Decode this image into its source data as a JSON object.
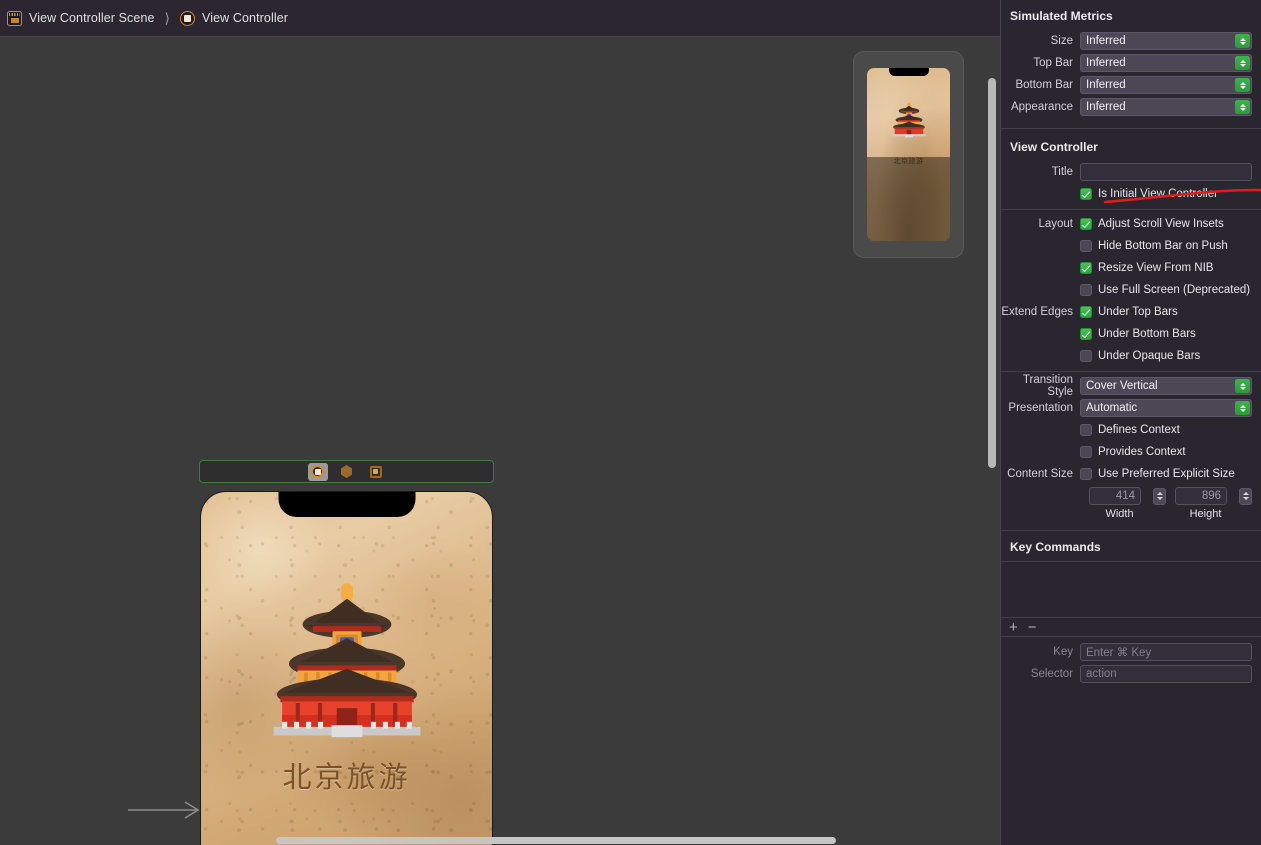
{
  "breadcrumb": {
    "scene": "View Controller Scene",
    "separator": "⟩",
    "controller": "View Controller"
  },
  "canvas": {
    "device_title": "北京旅游",
    "thumb_title": "北京旅游",
    "dock_items": [
      {
        "name": "view-controller",
        "selected": true
      },
      {
        "name": "first-responder",
        "selected": false
      },
      {
        "name": "exit",
        "selected": false
      }
    ]
  },
  "inspector": {
    "simulated_metrics": {
      "header": "Simulated Metrics",
      "rows": [
        {
          "label": "Size",
          "value": "Inferred"
        },
        {
          "label": "Top Bar",
          "value": "Inferred"
        },
        {
          "label": "Bottom Bar",
          "value": "Inferred"
        },
        {
          "label": "Appearance",
          "value": "Inferred"
        }
      ]
    },
    "view_controller": {
      "header": "View Controller",
      "title_label": "Title",
      "title_value": "",
      "is_initial_label": "Is Initial View Controller",
      "is_initial_checked": true,
      "layout_label": "Layout",
      "layout_items": [
        {
          "label": "Adjust Scroll View Insets",
          "checked": true
        },
        {
          "label": "Hide Bottom Bar on Push",
          "checked": false
        },
        {
          "label": "Resize View From NIB",
          "checked": true
        },
        {
          "label": "Use Full Screen (Deprecated)",
          "checked": false
        }
      ],
      "extend_edges_label": "Extend Edges",
      "extend_edges_items": [
        {
          "label": "Under Top Bars",
          "checked": true
        },
        {
          "label": "Under Bottom Bars",
          "checked": true
        },
        {
          "label": "Under Opaque Bars",
          "checked": false
        }
      ],
      "transition_style_label": "Transition Style",
      "transition_style_value": "Cover Vertical",
      "presentation_label": "Presentation",
      "presentation_value": "Automatic",
      "context_items": [
        {
          "label": "Defines Context",
          "checked": false
        },
        {
          "label": "Provides Context",
          "checked": false
        }
      ],
      "content_size_label": "Content Size",
      "content_size_item": {
        "label": "Use Preferred Explicit Size",
        "checked": false
      },
      "width_value": "414",
      "height_value": "896",
      "width_caption": "Width",
      "height_caption": "Height"
    },
    "key_commands": {
      "header": "Key Commands",
      "add_button": "+",
      "remove_button": "−",
      "key_label": "Key",
      "key_placeholder": "Enter ⌘ Key",
      "selector_label": "Selector",
      "selector_placeholder": "action"
    }
  },
  "annotation": {
    "color": "#e01b1b",
    "target": "Is Initial View Controller"
  }
}
